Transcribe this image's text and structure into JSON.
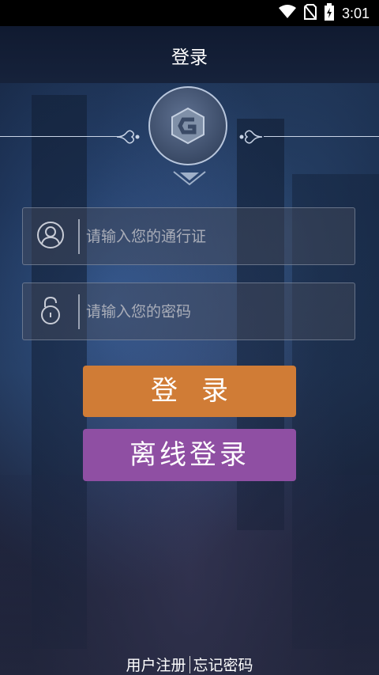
{
  "status_bar": {
    "time": "3:01",
    "icons": [
      "wifi-icon",
      "no-sim-icon",
      "battery-charging-icon"
    ]
  },
  "header": {
    "title": "登录"
  },
  "logo": {
    "icon": "game-logo-icon",
    "letter": "G"
  },
  "form": {
    "username": {
      "icon": "user-icon",
      "placeholder": "请输入您的通行证",
      "value": ""
    },
    "password": {
      "icon": "lock-icon",
      "placeholder": "请输入您的密码",
      "value": ""
    }
  },
  "buttons": {
    "login_label": "登录",
    "offline_login_label": "离线登录"
  },
  "footer": {
    "register_label": "用户注册",
    "forgot_password_label": "忘记密码"
  },
  "colors": {
    "login_button": "#d07c36",
    "offline_button": "#8f4fa3"
  }
}
